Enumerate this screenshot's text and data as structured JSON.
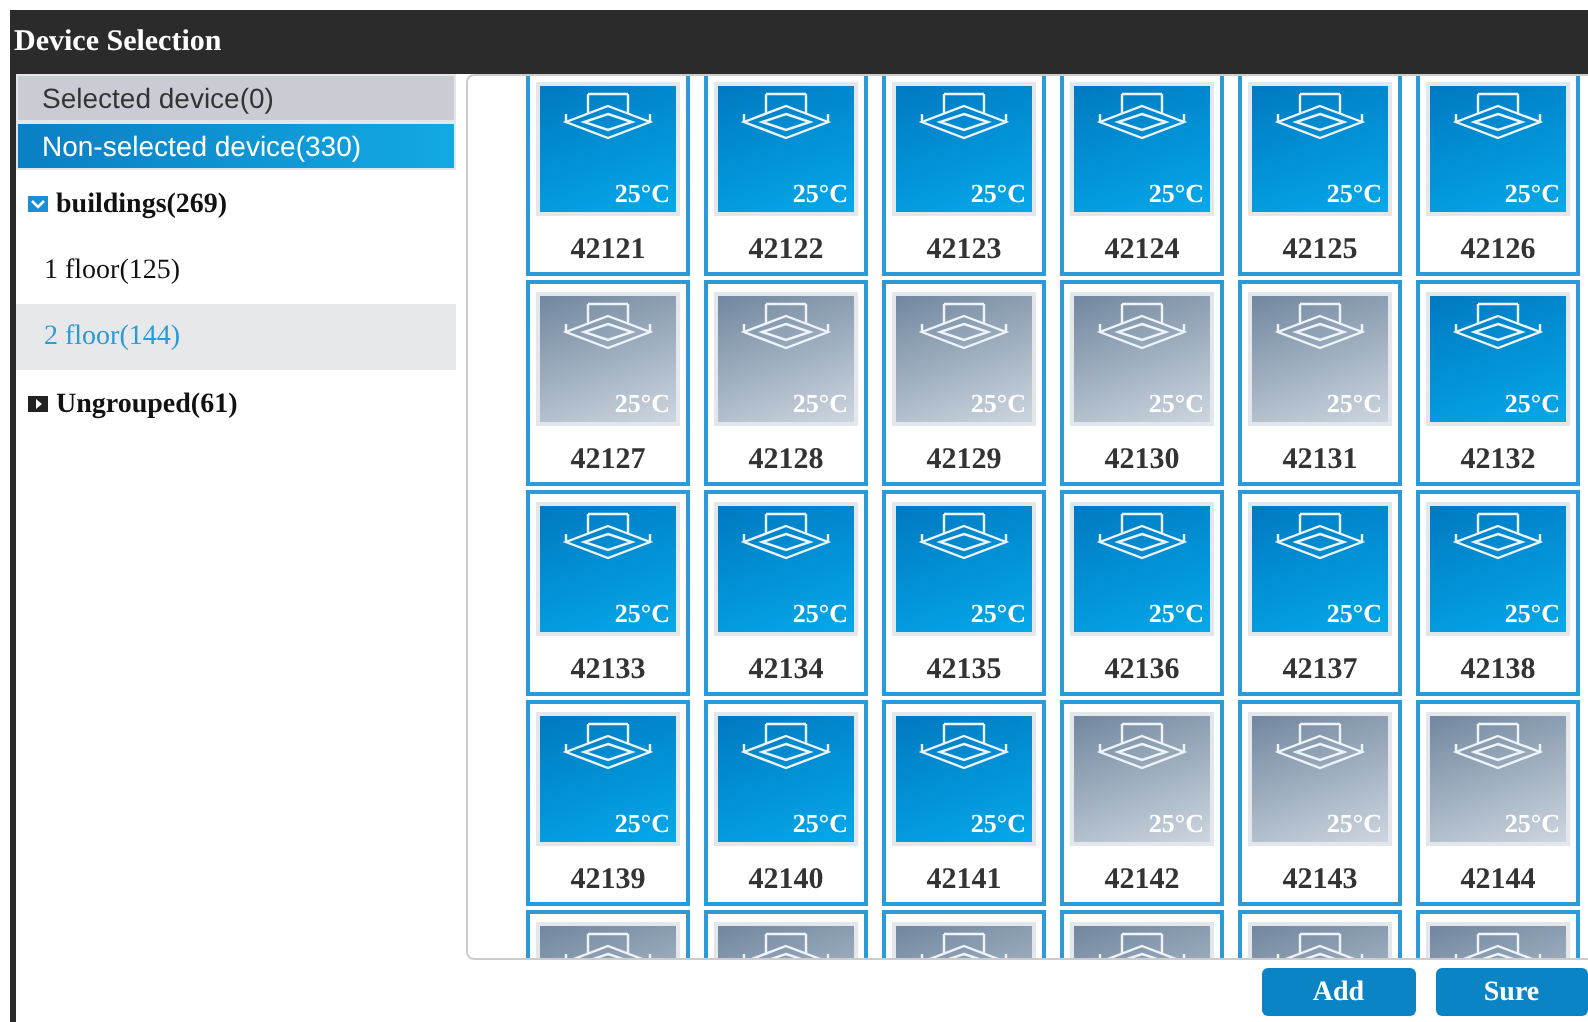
{
  "window": {
    "title": "Device Selection"
  },
  "device_tabs": [
    {
      "label": "Selected device(0)",
      "selected": false
    },
    {
      "label": "Non-selected device(330)",
      "selected": true
    }
  ],
  "tree": [
    {
      "label": "buildings(269)",
      "expanded": true,
      "children": [
        {
          "label": "1 floor(125)",
          "selected": false
        },
        {
          "label": "2 floor(144)",
          "selected": true
        }
      ]
    },
    {
      "label": "Ungrouped(61)",
      "expanded": false
    }
  ],
  "tiles": [
    {
      "number": "42121",
      "temp": "25°C",
      "on": true
    },
    {
      "number": "42122",
      "temp": "25°C",
      "on": true
    },
    {
      "number": "42123",
      "temp": "25°C",
      "on": true
    },
    {
      "number": "42124",
      "temp": "25°C",
      "on": true
    },
    {
      "number": "42125",
      "temp": "25°C",
      "on": true
    },
    {
      "number": "42126",
      "temp": "25°C",
      "on": true
    },
    {
      "number": "42127",
      "temp": "25°C",
      "on": false
    },
    {
      "number": "42128",
      "temp": "25°C",
      "on": false
    },
    {
      "number": "42129",
      "temp": "25°C",
      "on": false
    },
    {
      "number": "42130",
      "temp": "25°C",
      "on": false
    },
    {
      "number": "42131",
      "temp": "25°C",
      "on": false
    },
    {
      "number": "42132",
      "temp": "25°C",
      "on": true
    },
    {
      "number": "42133",
      "temp": "25°C",
      "on": true
    },
    {
      "number": "42134",
      "temp": "25°C",
      "on": true
    },
    {
      "number": "42135",
      "temp": "25°C",
      "on": true
    },
    {
      "number": "42136",
      "temp": "25°C",
      "on": true
    },
    {
      "number": "42137",
      "temp": "25°C",
      "on": true
    },
    {
      "number": "42138",
      "temp": "25°C",
      "on": true
    },
    {
      "number": "42139",
      "temp": "25°C",
      "on": true
    },
    {
      "number": "42140",
      "temp": "25°C",
      "on": true
    },
    {
      "number": "42141",
      "temp": "25°C",
      "on": true
    },
    {
      "number": "42142",
      "temp": "25°C",
      "on": false
    },
    {
      "number": "42143",
      "temp": "25°C",
      "on": false
    },
    {
      "number": "42144",
      "temp": "25°C",
      "on": false
    }
  ],
  "partial_tiles": [
    {
      "on": false
    },
    {
      "on": false
    },
    {
      "on": false
    },
    {
      "on": false
    },
    {
      "on": false
    },
    {
      "on": false
    }
  ],
  "buttons": [
    "Add",
    "Sure"
  ]
}
